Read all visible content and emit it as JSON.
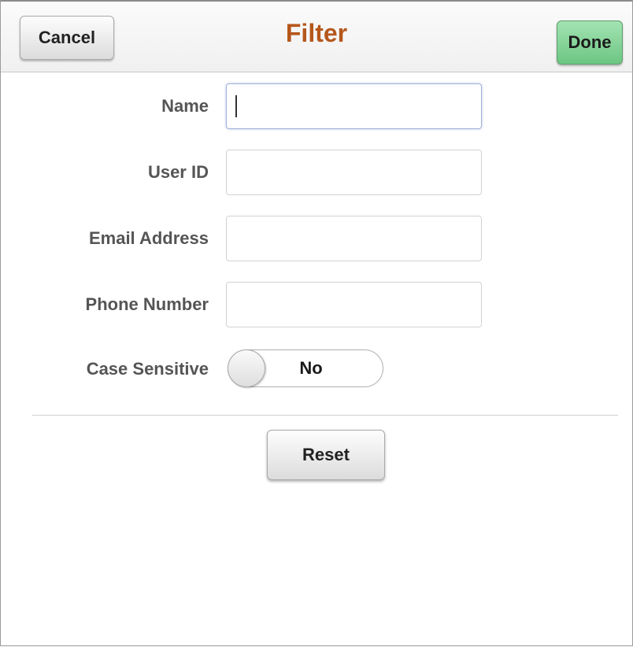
{
  "header": {
    "cancel_label": "Cancel",
    "title": "Filter",
    "done_label": "Done"
  },
  "form": {
    "fields": [
      {
        "label": "Name",
        "value": ""
      },
      {
        "label": "User ID",
        "value": ""
      },
      {
        "label": "Email Address",
        "value": ""
      },
      {
        "label": "Phone Number",
        "value": ""
      }
    ],
    "case_sensitive": {
      "label": "Case Sensitive",
      "value": "No"
    }
  },
  "actions": {
    "reset_label": "Reset"
  },
  "colors": {
    "title": "#b5571c",
    "done_button": "#6cc683",
    "label_text": "#555555"
  }
}
